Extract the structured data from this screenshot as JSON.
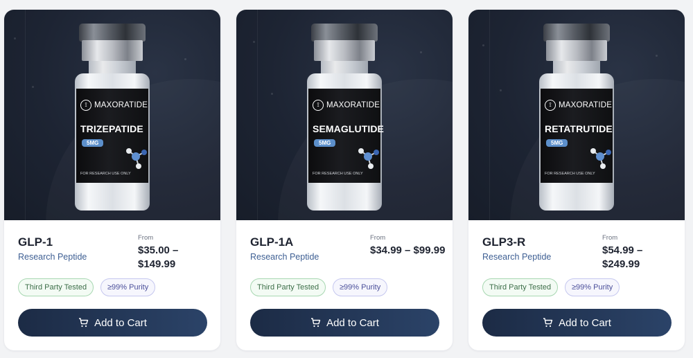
{
  "products": [
    {
      "vial_brand": "MAXORATIDE",
      "vial_name": "TRIZEPATIDE",
      "vial_dose": "5MG",
      "vial_note": "FOR RESEARCH USE ONLY",
      "title": "GLP-1",
      "subtitle": "Research Peptide",
      "from_label": "From",
      "price_range": "$35.00 – $149.99",
      "badges": [
        "Third Party Tested",
        "≥99% Purity"
      ],
      "cart_label": "Add to Cart"
    },
    {
      "vial_brand": "MAXORATIDE",
      "vial_name": "SEMAGLUTIDE",
      "vial_dose": "5MG",
      "vial_note": "FOR RESEARCH USE ONLY",
      "title": "GLP-1A",
      "subtitle": "Research Peptide",
      "from_label": "From",
      "price_range": "$34.99 – $99.99",
      "badges": [
        "Third Party Tested",
        "≥99% Purity"
      ],
      "cart_label": "Add to Cart"
    },
    {
      "vial_brand": "MAXORATIDE",
      "vial_name": "RETATRUTIDE",
      "vial_dose": "5MG",
      "vial_note": "FOR RESEARCH USE ONLY",
      "title": "GLP3-R",
      "subtitle": "Research Peptide",
      "from_label": "From",
      "price_range": "$54.99 – $249.99",
      "badges": [
        "Third Party Tested",
        "≥99% Purity"
      ],
      "cart_label": "Add to Cart"
    }
  ],
  "colors": {
    "hero_bg": "#1d2433",
    "button": "#1c2b45",
    "subtitle": "#3e5f93",
    "badge_green": "#a7d7b1",
    "badge_purple": "#c5c7ef",
    "dose_tag": "#5c8fcb"
  },
  "icons": {
    "cart": "shopping-cart-icon",
    "brand": "runner-logo-icon"
  }
}
